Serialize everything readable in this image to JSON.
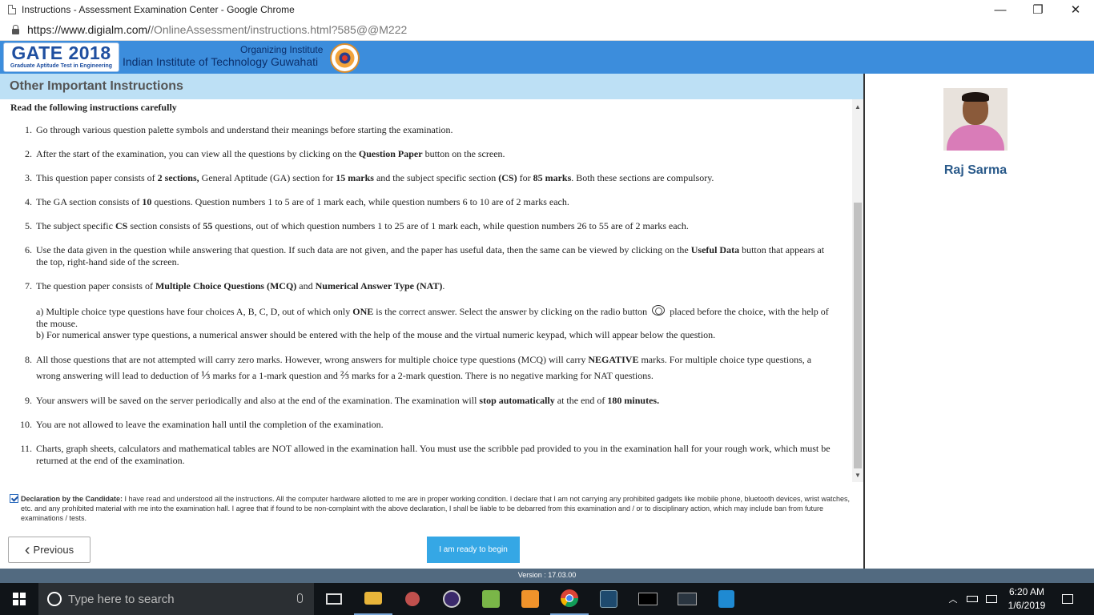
{
  "browser": {
    "window_title": "Instructions - Assessment Examination Center - Google Chrome",
    "minimize_glyph": "—",
    "restore_glyph": "❐",
    "close_glyph": "✕",
    "url_host": "https://www.digialm.com/",
    "url_path": "/OnlineAssessment/instructions.html?585@@M222"
  },
  "header": {
    "logo_title": "GATE 2018",
    "logo_subtitle": "Graduate Aptitude Test in Engineering",
    "organizing_label": "Organizing Institute",
    "institute_name": "Indian Institute of Technology Guwahati"
  },
  "section": {
    "title": "Other Important Instructions",
    "lead": "Read the following instructions carefully"
  },
  "instructions": [
    {
      "num": "1.",
      "text": "Go through various question palette symbols and understand their meanings before starting the examination."
    },
    {
      "num": "2.",
      "pre": "After the start of the examination, you can view all the questions by clicking on the ",
      "bold1": "Question Paper",
      "post": " button on the screen."
    },
    {
      "num": "3.",
      "pre": "This question paper consists of ",
      "bold1": "2 sections,",
      "mid1": " General Aptitude (GA) section for ",
      "bold2": "15 marks",
      "mid2": " and the subject specific section ",
      "bold3": "(CS)",
      "mid3": " for ",
      "bold4": "85 marks",
      "post": ". Both these sections are compulsory."
    },
    {
      "num": "4.",
      "pre": "The GA section consists of ",
      "bold1": "10",
      "post": " questions. Question numbers 1 to 5 are of 1 mark each, while question numbers 6 to 10 are of 2 marks each."
    },
    {
      "num": "5.",
      "pre": "The subject specific ",
      "bold1": "CS",
      "mid1": " section consists of ",
      "bold2": "55",
      "post": " questions, out of which question numbers 1 to 25 are of 1 mark each, while question numbers 26 to 55 are of 2 marks each."
    },
    {
      "num": "6.",
      "pre": "Use the data given in the question while answering that question. If such data are not given, and the paper has useful data, then the same can be viewed by clicking on the ",
      "bold1": "Useful Data",
      "post": " button that appears at the top, right-hand side of the screen."
    },
    {
      "num": "7.",
      "pre": "The question paper consists of ",
      "bold1": "Multiple Choice Questions (MCQ)",
      "mid1": " and ",
      "bold2": "Numerical Answer Type (NAT)",
      "post": "."
    },
    {
      "sub_a_pre": "a) Multiple choice type questions have four choices A, B, C, D, out of which only ",
      "sub_a_bold": "ONE",
      "sub_a_mid": " is the correct answer. Select the answer by clicking on the radio button ",
      "sub_a_post": " placed before the choice, with the help of the mouse.",
      "sub_b": "b) For numerical answer type questions, a numerical answer should be entered with the help of the mouse and the virtual numeric keypad, which will appear below the question."
    },
    {
      "num": "8.",
      "pre": "All those questions that are not attempted will carry zero marks. However, wrong answers for multiple choice type questions (MCQ) will carry ",
      "bold1": "NEGATIVE",
      "mid1": " marks. For multiple choice type questions, a wrong answering will lead to deduction of ",
      "frac1": "⅓",
      "mid2": " marks for a 1-mark question and ",
      "frac2": "⅔",
      "post": " marks for a 2-mark question. There is no negative marking for NAT questions."
    },
    {
      "num": "9.",
      "pre": "Your answers will be saved on the server periodically and also at the end of the examination. The examination will ",
      "bold1": "stop automatically",
      "mid1": " at the end of ",
      "bold2": "180 minutes.",
      "post": ""
    },
    {
      "num": "10.",
      "text": "You are not allowed to leave the examination hall until the completion of the examination."
    },
    {
      "num": "11.",
      "text": "Charts, graph sheets, calculators and mathematical tables are NOT allowed in the examination hall. You must use the scribble pad provided to you in the examination hall for your rough work, which must be returned at the end of the examination."
    }
  ],
  "candidate": {
    "name": "Raj Sarma"
  },
  "declaration": {
    "checked": true,
    "label": "Declaration by the Candidate:",
    "text": " I have read and understood all the instructions. All the computer hardware allotted to me are in proper working condition. I declare that I am not carrying any prohibited gadgets like mobile phone, bluetooth devices, wrist watches, etc. and any prohibited material with me into the examination hall. I agree that if found to be non-complaint with the above declaration, I shall be liable to be debarred from this examination and / or to disciplinary action, which may include ban from future examinations / tests."
  },
  "buttons": {
    "previous": "Previous",
    "ready": "I am ready to begin"
  },
  "version": "Version : 17.03.00",
  "taskbar": {
    "search_placeholder": "Type here to search",
    "time": "6:20 AM",
    "date": "1/6/2019",
    "apps": [
      "task-view",
      "file-explorer",
      "snipping-tool",
      "eclipse",
      "notepad-plus",
      "sublime-text",
      "chrome",
      "mysql-workbench",
      "terminal",
      "mysql-shell",
      "vscode"
    ]
  },
  "colors": {
    "header_blue": "#3c8ddc",
    "section_bg": "#bde0f5",
    "button_blue": "#35a7e5",
    "name_color": "#2a5a8a"
  }
}
